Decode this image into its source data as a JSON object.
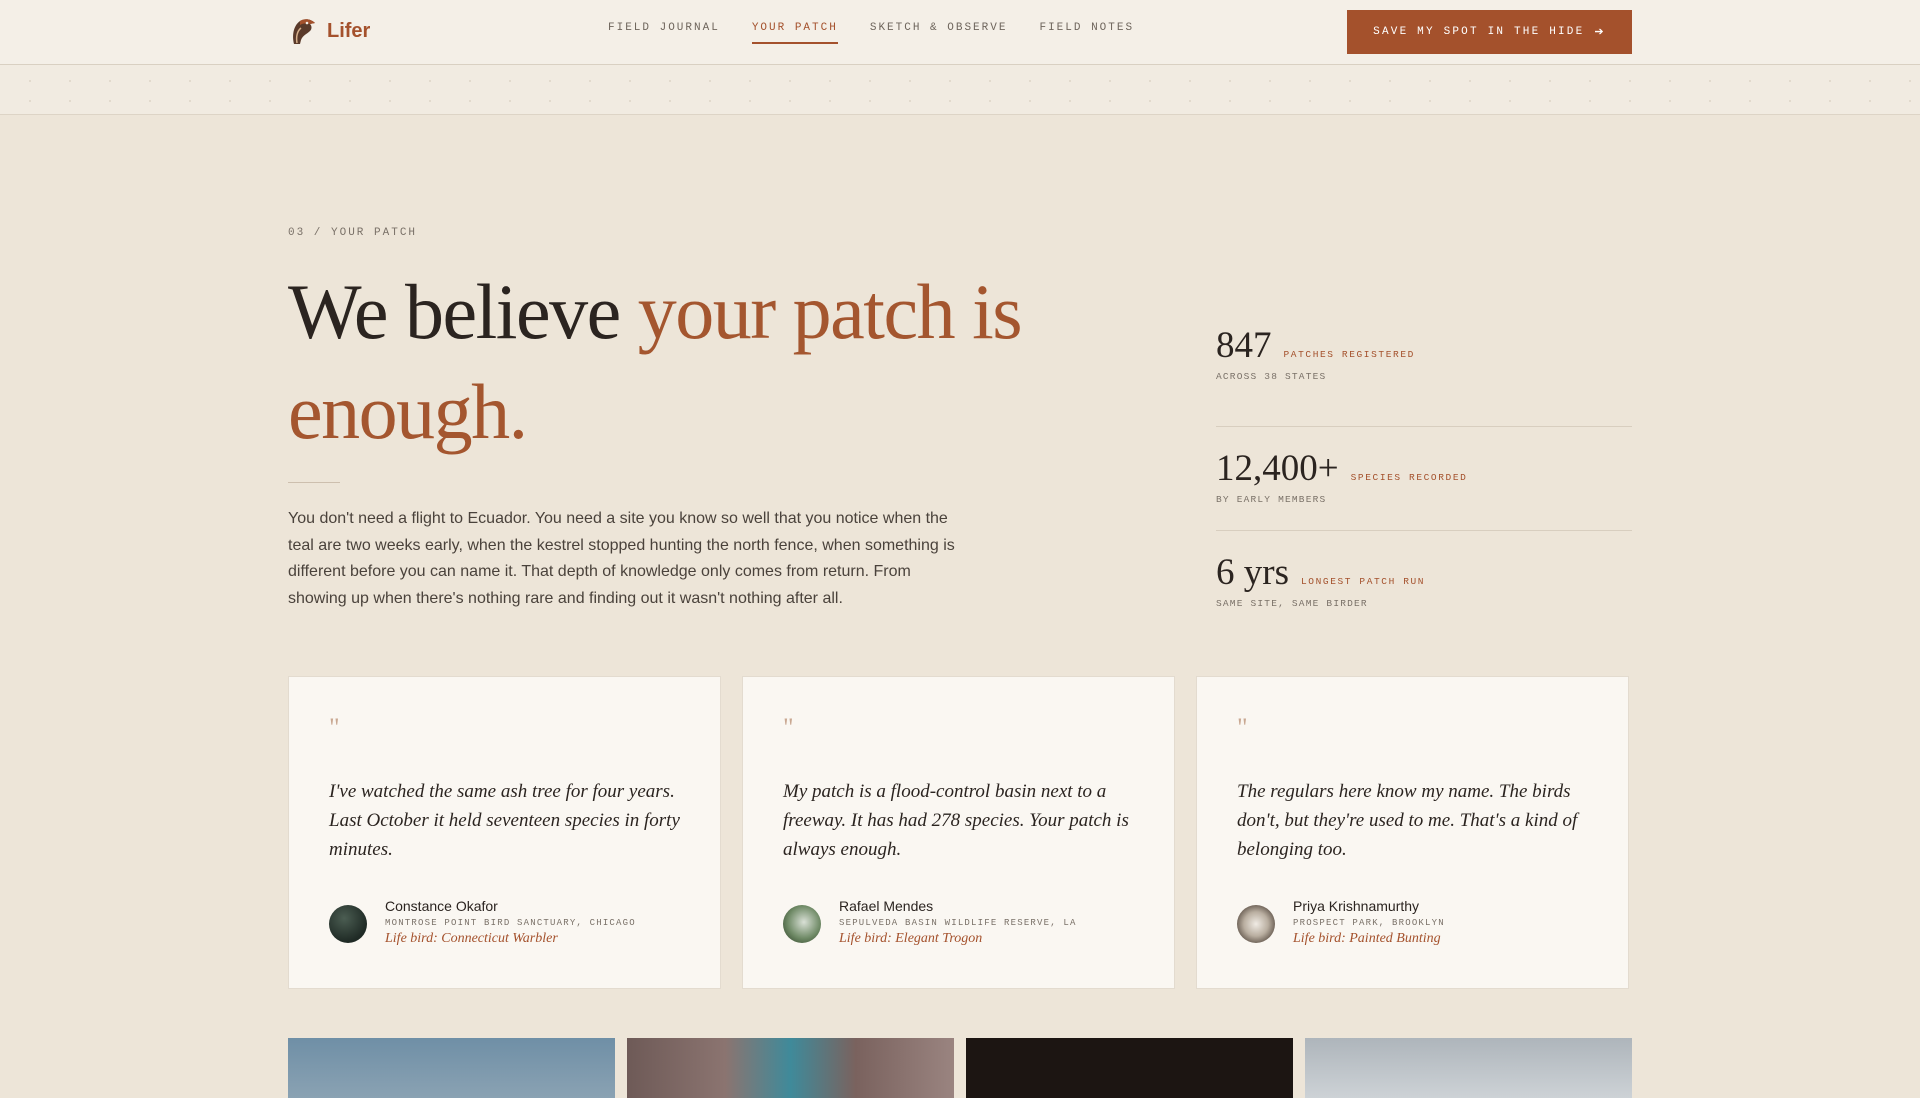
{
  "brand": {
    "name": "Lifer",
    "logo_icon": "bird-head-icon"
  },
  "nav": {
    "items": [
      {
        "label": "FIELD JOURNAL",
        "active": false
      },
      {
        "label": "YOUR PATCH",
        "active": true
      },
      {
        "label": "SKETCH & OBSERVE",
        "active": false
      },
      {
        "label": "FIELD NOTES",
        "active": false
      }
    ]
  },
  "cta": {
    "label": "SAVE MY SPOT IN THE HIDE",
    "icon": "arrow-right-icon"
  },
  "hero": {
    "eyebrow": "03 / YOUR PATCH",
    "headline_plain": "We believe ",
    "headline_accent": "your patch is enough.",
    "lede": "You don't need a flight to Ecuador. You need a site you know so well that you notice when the teal are two weeks early, when the kestrel stopped hunting the north fence, when something is different before you can name it. That depth of knowledge only comes from return. From showing up when there's nothing rare and finding out it wasn't nothing after all."
  },
  "stats": [
    {
      "value": "847",
      "label": "PATCHES REGISTERED",
      "sub": "ACROSS 38 STATES"
    },
    {
      "value": "12,400+",
      "label": "SPECIES RECORDED",
      "sub": "BY EARLY MEMBERS"
    },
    {
      "value": "6 yrs",
      "label": "LONGEST PATCH RUN",
      "sub": "SAME SITE, SAME BIRDER"
    }
  ],
  "testimonials": [
    {
      "mark": "\"",
      "quote": "I've watched the same ash tree for four years. Last October it held seventeen species in forty minutes.",
      "name": "Constance Okafor",
      "location": "MONTROSE POINT BIRD SANCTUARY, CHICAGO",
      "life_bird": "Life bird: Connecticut Warbler"
    },
    {
      "mark": "\"",
      "quote": "My patch is a flood-control basin next to a freeway. It has had 278 species. Your patch is always enough.",
      "name": "Rafael Mendes",
      "location": "SEPULVEDA BASIN WILDLIFE RESERVE, LA",
      "life_bird": "Life bird: Elegant Trogon"
    },
    {
      "mark": "\"",
      "quote": "The regulars here know my name. The birds don't, but they're used to me. That's a kind of belonging too.",
      "name": "Priya Krishnamurthy",
      "location": "PROSPECT PARK, BROOKLYN",
      "life_bird": "Life bird: Painted Bunting"
    }
  ],
  "colors": {
    "accent": "#a4512c",
    "background": "#ede5d8",
    "ink": "#2b2420"
  }
}
